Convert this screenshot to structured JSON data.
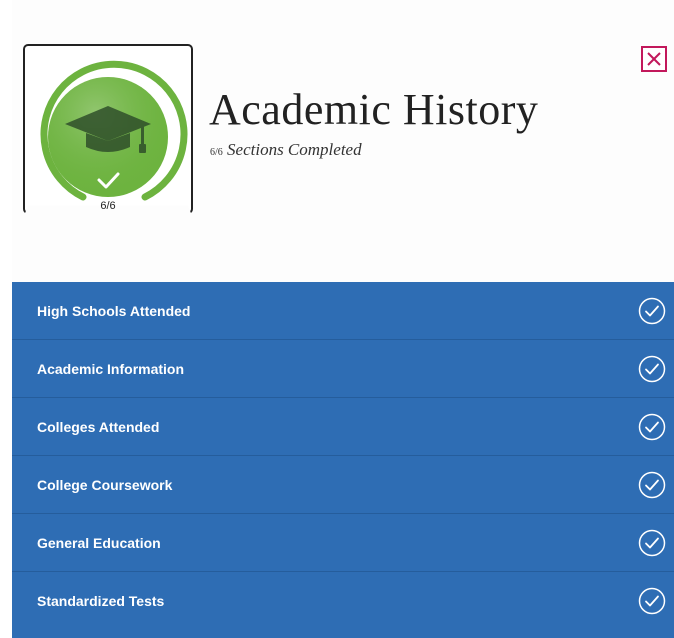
{
  "header": {
    "title": "Academic History",
    "subtitle_count": "6/6",
    "subtitle_text": "Sections Completed",
    "badge_count": "6/6",
    "badge_progress": 1.0
  },
  "colors": {
    "accent_green": "#6db33f",
    "section_blue": "#2e6db4",
    "close_red": "#c2185b"
  },
  "sections": [
    {
      "label": "High Schools Attended",
      "status": "complete"
    },
    {
      "label": "Academic Information",
      "status": "complete"
    },
    {
      "label": "Colleges Attended",
      "status": "complete"
    },
    {
      "label": "College Coursework",
      "status": "complete"
    },
    {
      "label": "General Education",
      "status": "complete"
    },
    {
      "label": "Standardized Tests",
      "status": "complete"
    }
  ]
}
